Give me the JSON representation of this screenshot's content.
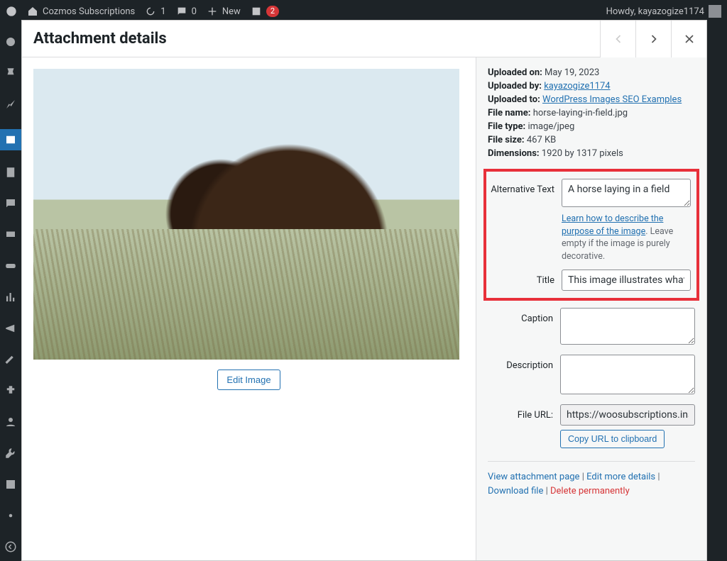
{
  "adminbar": {
    "site_name": "Cozmos Subscriptions",
    "updates": "1",
    "comments": "0",
    "new_label": "New",
    "yoast_count": "2",
    "howdy": "Howdy, kayazogize1174"
  },
  "modal": {
    "title": "Attachment details",
    "prev_label": "Previous",
    "next_label": "Next",
    "close_label": "Close"
  },
  "edit_image_label": "Edit Image",
  "meta": {
    "uploaded_on_label": "Uploaded on:",
    "uploaded_on": "May 19, 2023",
    "uploaded_by_label": "Uploaded by:",
    "uploaded_by": "kayazogize1174",
    "uploaded_to_label": "Uploaded to:",
    "uploaded_to": "WordPress Images SEO Examples",
    "file_name_label": "File name:",
    "file_name": "horse-laying-in-field.jpg",
    "file_type_label": "File type:",
    "file_type": "image/jpeg",
    "file_size_label": "File size:",
    "file_size": "467 KB",
    "dimensions_label": "Dimensions:",
    "dimensions": "1920 by 1317 pixels"
  },
  "fields": {
    "alt_label": "Alternative Text",
    "alt_value": "A horse laying in a field",
    "alt_help_link": "Learn how to describe the purpose of the image",
    "alt_help_rest": ". Leave empty if the image is purely decorative.",
    "title_label": "Title",
    "title_value": "This image illustrates what a",
    "caption_label": "Caption",
    "caption_value": "",
    "description_label": "Description",
    "description_value": "",
    "file_url_label": "File URL:",
    "file_url_value": "https://woosubscriptions.inst",
    "copy_url_label": "Copy URL to clipboard"
  },
  "links": {
    "view_page": "View attachment page",
    "edit_more": "Edit more details",
    "download": "Download file",
    "delete": "Delete permanently"
  }
}
